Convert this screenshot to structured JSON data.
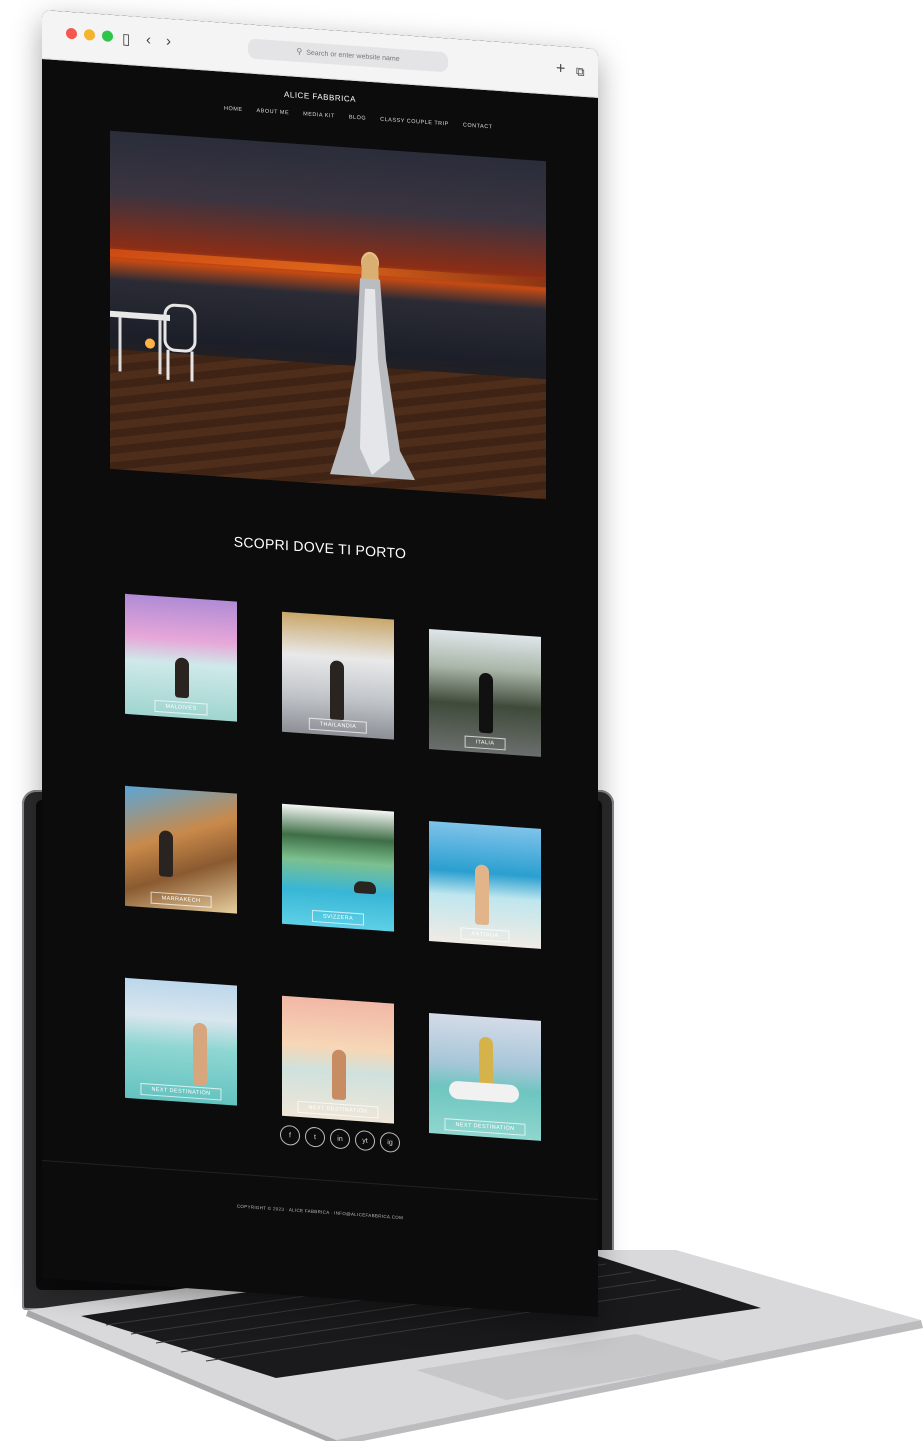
{
  "browser": {
    "address_placeholder": "Search or enter website name"
  },
  "site": {
    "brand": "ALICE FABBRICA",
    "menu": [
      "HOME",
      "ABOUT ME",
      "MEDIA KIT",
      "BLOG",
      "CLASSY COUPLE TRIP",
      "CONTACT"
    ],
    "section_title": "SCOPRI DOVE TI PORTO",
    "destinations": [
      {
        "label": "MALDIVES"
      },
      {
        "label": "THAILANDIA"
      },
      {
        "label": "ITALIA"
      },
      {
        "label": "MARRAKECH"
      },
      {
        "label": "SVIZZERA"
      },
      {
        "label": "ANTIGUA"
      },
      {
        "label": "NEXT DESTINATION"
      },
      {
        "label": "NEXT DESTINATION"
      },
      {
        "label": "NEXT DESTINATION"
      }
    ],
    "social": [
      "f",
      "t",
      "in",
      "yt",
      "ig"
    ],
    "copyright": "COPYRIGHT © 2023 · ALICE FABBRICA · INFO@ALICEFABBRICA.COM"
  }
}
